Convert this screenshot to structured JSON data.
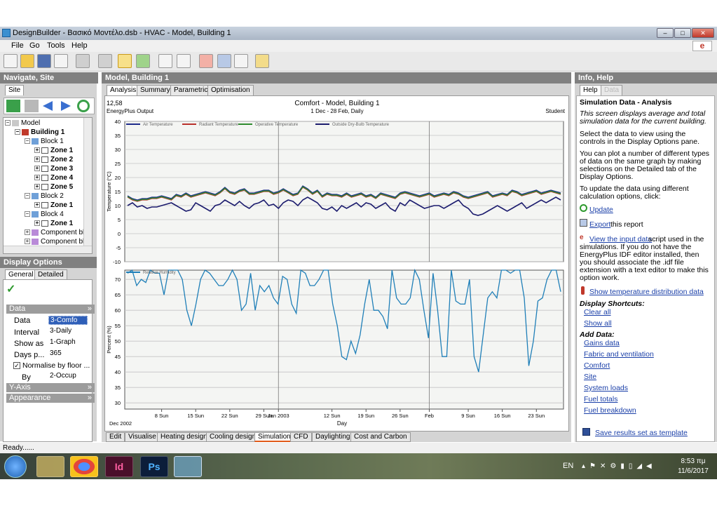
{
  "window": {
    "title": "DesignBuilder - Βασικό Μοντέλο.dsb - HVAC - Model, Building 1",
    "min": "–",
    "max": "□",
    "close": "✕"
  },
  "menu": [
    "File",
    "Go",
    "Tools",
    "Help"
  ],
  "toolbar": [
    "new-file",
    "open-folder",
    "save",
    "print",
    "edit",
    "tools-wrench",
    "chart-analysis",
    "refresh",
    "list",
    "grid",
    "target",
    "image",
    "document",
    "wizard"
  ],
  "left": {
    "header": "Navigate, Site",
    "tab": "Site",
    "tree": [
      {
        "label": "Model",
        "bold": false
      },
      {
        "label": "Building 1",
        "bold": true
      },
      {
        "label": "Block 1",
        "bold": false
      },
      {
        "label": "Zone 1",
        "bold": true
      },
      {
        "label": "Zone 2",
        "bold": true
      },
      {
        "label": "Zone 3",
        "bold": true
      },
      {
        "label": "Zone 4",
        "bold": true
      },
      {
        "label": "Zone 5",
        "bold": true
      },
      {
        "label": "Block 2",
        "bold": false
      },
      {
        "label": "Zone 1",
        "bold": true
      },
      {
        "label": "Block 4",
        "bold": false
      },
      {
        "label": "Zone 1",
        "bold": true
      },
      {
        "label": "Component bl",
        "bold": false
      },
      {
        "label": "Component bl",
        "bold": false
      }
    ],
    "display_options": "Display Options",
    "tab_general": "General",
    "tab_detailed": "Detailed",
    "sec_data": "Data",
    "data_label": "Data",
    "data_value": "3-Comfo",
    "interval_label": "Interval",
    "interval_value": "3-Daily",
    "showas_label": "Show as",
    "showas_value": "1-Graph",
    "days_label": "Days p...",
    "days_value": "365",
    "normalise": "Normalise by floor ...",
    "by_label": "By",
    "by_value": "2-Occup",
    "sec_yaxis": "Y-Axis",
    "sec_appearance": "Appearance"
  },
  "centre": {
    "header": "Model, Building 1",
    "tabs": [
      "Analysis",
      "Summary",
      "Parametric",
      "Optimisation"
    ],
    "bottom_tabs": [
      "Edit",
      "Visualise",
      "Heating design",
      "Cooling design",
      "Simulation",
      "CFD",
      "Daylighting",
      "Cost and Carbon"
    ]
  },
  "chart_data": [
    {
      "type": "line",
      "title": "Comfort - Model, Building 1",
      "subtitle": "1 Dec - 28 Feb, Daily",
      "top_left_1": "12,58",
      "top_left_2": "EnergyPlus Output",
      "top_right": "Student",
      "ylabel": "Temperature (°C)",
      "ylim": [
        -10,
        40
      ],
      "yticks": [
        40,
        35,
        30,
        25,
        20,
        15,
        10,
        5,
        0,
        -5,
        -10
      ],
      "grid": true,
      "legend_placement": "top-left",
      "series": [
        {
          "name": "Air Temperature",
          "color": "#1e2a8a",
          "values": [
            13.5,
            12.5,
            12,
            12.5,
            12.5,
            13,
            13,
            13.5,
            13,
            12.5,
            14,
            13.5,
            14.5,
            13.5,
            14,
            14.5,
            15,
            14.5,
            14,
            15,
            16.5,
            15,
            14.5,
            15.5,
            16,
            14.5,
            14.5,
            15,
            15.5,
            15.5,
            14.5,
            15,
            16,
            15,
            14,
            14.5,
            17,
            16,
            14.5,
            15.5,
            13.5,
            14.5,
            14,
            14,
            13.5,
            14.5,
            13.5,
            14,
            14.5,
            13.5,
            14,
            13,
            14.5,
            14,
            13.5,
            13,
            14.5,
            15,
            14.5,
            14,
            13.5,
            14,
            14.5,
            13.5,
            14,
            14.5,
            14,
            15,
            14.5,
            13.5,
            13,
            13.5,
            14,
            14.5,
            15,
            13.5,
            14,
            14.5,
            14,
            15.5,
            15,
            14,
            14.5,
            15,
            15.5,
            14.5,
            15,
            15.5,
            15,
            14.5
          ]
        },
        {
          "name": "Radiant Temperature",
          "color": "#b8302a",
          "values": [
            13,
            12,
            11.5,
            12,
            12,
            12.5,
            12.5,
            13,
            12.5,
            12,
            13.5,
            13,
            14,
            13,
            13.5,
            14,
            14.5,
            14,
            13.5,
            14.5,
            16,
            14.5,
            14,
            15,
            15.5,
            14,
            14,
            14.5,
            15,
            15,
            14,
            14.5,
            15.5,
            14.5,
            13.5,
            14,
            16.5,
            15.5,
            14,
            15,
            13,
            14,
            13.5,
            13.5,
            13,
            14,
            13,
            13.5,
            14,
            13,
            13.5,
            12.5,
            14,
            13.5,
            13,
            12.5,
            14,
            14.5,
            14,
            13.5,
            13,
            13.5,
            14,
            13,
            13.5,
            14,
            13.5,
            14.5,
            14,
            13,
            12.5,
            13,
            13.5,
            14,
            14.5,
            13,
            13.5,
            14,
            13.5,
            15,
            14.5,
            13.5,
            14,
            14.5,
            15,
            14,
            14.5,
            15,
            14.5,
            14
          ]
        },
        {
          "name": "Operative Temperature",
          "color": "#2e8a2e",
          "values": [
            13.2,
            12.2,
            11.7,
            12.2,
            12.2,
            12.7,
            12.7,
            13.2,
            12.7,
            12.2,
            13.7,
            13.2,
            14.2,
            13.2,
            13.7,
            14.2,
            14.7,
            14.2,
            13.7,
            14.7,
            16.2,
            14.7,
            14.2,
            15.2,
            15.7,
            14.2,
            14.2,
            14.7,
            15.2,
            15.2,
            14.2,
            14.7,
            15.7,
            14.7,
            13.7,
            14.2,
            16.7,
            15.7,
            14.2,
            15.2,
            13.2,
            14.2,
            13.7,
            13.7,
            13.2,
            14.2,
            13.2,
            13.7,
            14.2,
            13.2,
            13.7,
            12.7,
            14.2,
            13.7,
            13.2,
            12.7,
            14.2,
            14.7,
            14.2,
            13.7,
            13.2,
            13.7,
            14.2,
            13.2,
            13.7,
            14.2,
            13.7,
            14.7,
            14.2,
            13.2,
            12.7,
            13.2,
            13.7,
            14.2,
            14.7,
            13.2,
            13.7,
            14.2,
            13.7,
            15.2,
            14.7,
            13.7,
            14.2,
            14.7,
            15.2,
            14.2,
            14.7,
            15.2,
            14.7,
            14.2
          ]
        },
        {
          "name": "Outside Dry-Bulb Temperature",
          "color": "#1c1c6e",
          "values": [
            10,
            11,
            9.5,
            10,
            9,
            9.5,
            9.5,
            10,
            10.5,
            11,
            10,
            9,
            8,
            8.5,
            11,
            10,
            9,
            8,
            10,
            10.5,
            12,
            11,
            10,
            11.5,
            10,
            9,
            10.5,
            11,
            12,
            10,
            10.5,
            9,
            11,
            12,
            11.5,
            10,
            12,
            13,
            12,
            11,
            9,
            8.5,
            9.5,
            8,
            10,
            9,
            10,
            11,
            9.5,
            11,
            10.5,
            9,
            10,
            11,
            9,
            8,
            11,
            10,
            12,
            11,
            10,
            9,
            9.5,
            10,
            10,
            9,
            10,
            11,
            12,
            10,
            9,
            7,
            6.5,
            7,
            8,
            9,
            10,
            9,
            8,
            9,
            10,
            11,
            9,
            10,
            11,
            12,
            11,
            12,
            13,
            12
          ]
        }
      ]
    },
    {
      "type": "line",
      "ylabel": "Percent (%)",
      "xlabel": "Day",
      "ylim": [
        28,
        73
      ],
      "yticks": [
        70,
        65,
        60,
        55,
        50,
        45,
        40,
        35,
        30
      ],
      "grid": true,
      "x_start_label": "Dec 2002",
      "x_tick_labels": [
        "8 Sun",
        "15 Sun",
        "22 Sun",
        "29 Sun",
        "Jan 2003",
        "12 Sun",
        "19 Sun",
        "26 Sun",
        "Feb",
        "9 Sun",
        "16 Sun",
        "23 Sun"
      ],
      "series": [
        {
          "name": "Relative Humidity",
          "color": "#1f7fb8",
          "values": [
            72,
            73,
            68,
            70,
            69,
            73,
            72,
            72,
            65,
            73,
            73,
            73,
            70,
            60,
            55,
            62,
            70,
            73,
            72,
            70,
            68,
            68,
            70,
            73,
            70,
            60,
            62,
            72,
            60,
            68,
            66,
            68,
            64,
            62,
            71,
            70,
            62,
            59,
            73,
            72,
            68,
            68,
            70,
            73,
            73,
            62,
            55,
            45,
            44,
            50,
            46,
            52,
            62,
            70,
            60,
            60,
            58,
            54,
            73,
            64,
            62,
            62,
            64,
            73,
            70,
            60,
            51,
            72,
            60,
            45,
            45,
            73,
            63,
            62,
            62,
            70,
            45,
            40,
            52,
            64,
            66,
            64,
            73,
            73,
            72,
            73,
            73,
            64,
            42,
            50,
            63,
            64,
            70,
            73,
            73,
            66
          ]
        }
      ]
    }
  ],
  "right": {
    "header": "Info, Help",
    "tab_help": "Help",
    "tab_data": "Data",
    "title": "Simulation Data - Analysis",
    "italic": "This screen displays average and total simulation data for the current building.",
    "p1": "Select the data to view using the controls in the Display Options pane.",
    "p2": "You can plot a number of different types of data on the same graph by making selections on the Detailed tab of the Display Options.",
    "p3": "To update the data using different calculation options, click:",
    "update": "Update",
    "export": "Export",
    "export_tail": "this report",
    "view_input": "View the input data",
    "view_tail": "script used in the simulations.  If you do not have the EnergyPlus IDF editor installed, then you should associate the .idf file extension with a text editor to make this option work.",
    "temp_dist": "Show temperature distribution data",
    "shortcuts_title": "Display Shortcuts:",
    "clear_all": "Clear all",
    "show_all": "Show all",
    "add_title": "Add Data:",
    "add_items": [
      "Gains data",
      "Fabric and ventilation",
      "Comfort",
      "Site",
      "System loads",
      "Fuel totals",
      "Fuel breakdown"
    ],
    "save_template": "Save results set as template"
  },
  "status": "Ready......",
  "taskbar": {
    "lang": "EN",
    "time": "8:53 πμ",
    "date": "11/6/2017",
    "apps": [
      "start",
      "explorer",
      "chrome",
      "indesign",
      "photoshop",
      "designbuilder"
    ],
    "indesign_label": "Id",
    "photoshop_label": "Ps"
  }
}
